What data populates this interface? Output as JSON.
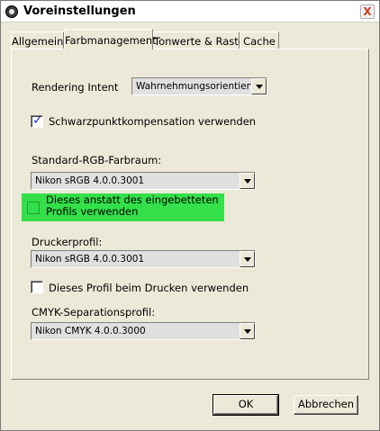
{
  "window": {
    "title": "Voreinstellungen",
    "close_label": "X"
  },
  "tabs": [
    {
      "label": "Allgemein"
    },
    {
      "label": "Farbmanagement"
    },
    {
      "label": "Tonwerte & Raster"
    },
    {
      "label": "Cache"
    }
  ],
  "rendering": {
    "label": "Rendering Intent",
    "value": "Wahrnehmungsorientiert"
  },
  "blackpoint": {
    "label": "Schwarzpunktkompensation verwenden",
    "checked": true
  },
  "rgb": {
    "label": "Standard-RGB-Farbraum:",
    "value": "Nikon sRGB 4.0.0.3001",
    "override_label": "Dieses anstatt des eingebetteten Profils verwenden",
    "highlight_color": "#33e04a"
  },
  "printer": {
    "label": "Druckerprofil:",
    "value": "Nikon sRGB 4.0.0.3001",
    "use_label": "Dieses Profil beim Drucken verwenden"
  },
  "cmyk": {
    "label": "CMYK-Separationsprofil:",
    "value": "Nikon CMYK 4.0.0.3000"
  },
  "buttons": {
    "ok": "OK",
    "cancel": "Abbrechen"
  }
}
